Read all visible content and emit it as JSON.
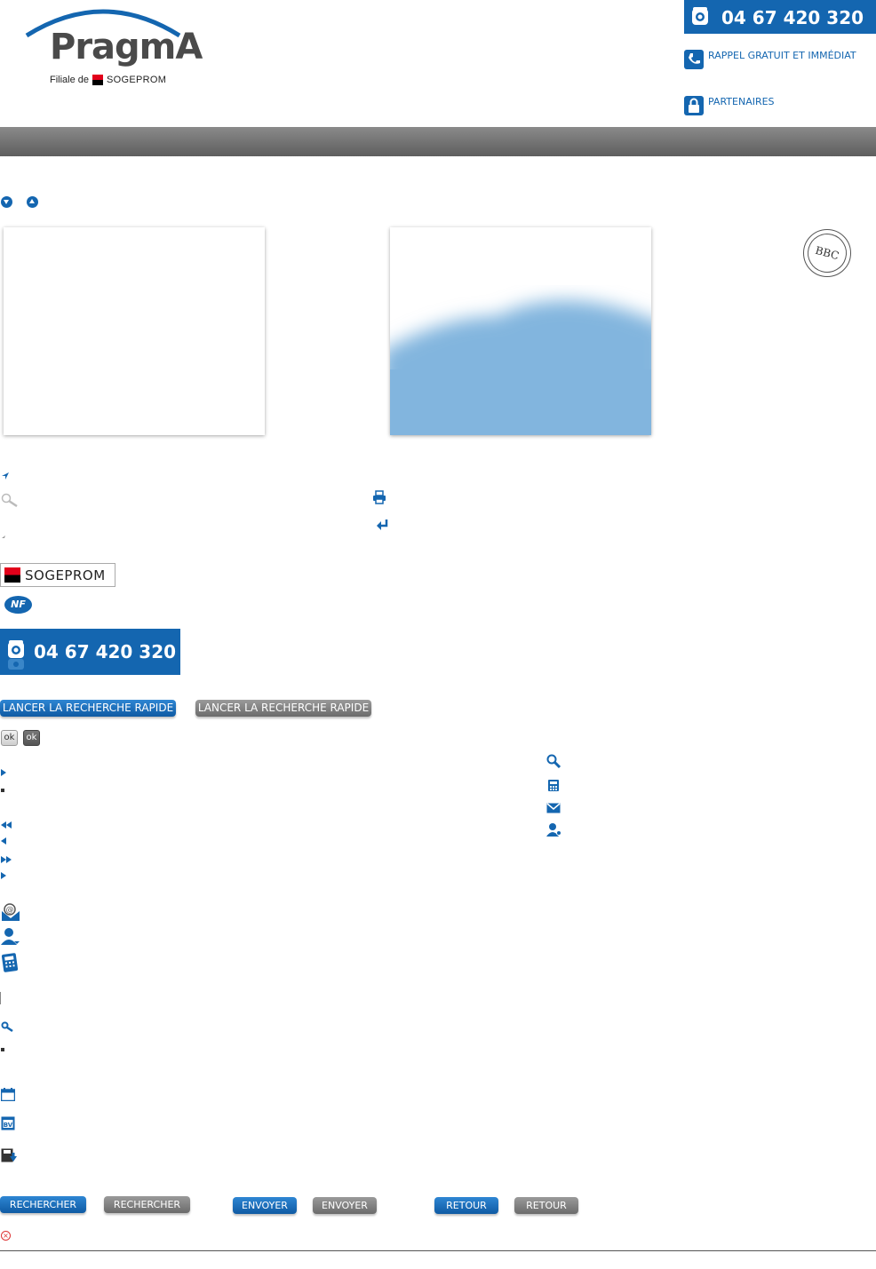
{
  "header": {
    "logo_text": "PragmA",
    "logo_sub_prefix": "Filiale de",
    "logo_sub_brand": "SOGEPROM",
    "phone": "04 67 420 320",
    "callback_label": "RAPPEL GRATUIT ET IMMÉDIAT",
    "partners_label": "PARTENAIRES"
  },
  "badges": {
    "bbc": "BBC",
    "sogeprom": "SOGEPROM",
    "nf": "NF"
  },
  "phone_box": {
    "number": "04 67 420 320"
  },
  "buttons": {
    "quick_search_blue": "LANCER LA RECHERCHE RAPIDE",
    "quick_search_grey": "LANCER LA RECHERCHE RAPIDE",
    "ok_light": "ok",
    "ok_dark": "ok",
    "search_blue": "RECHERCHER",
    "search_grey": "RECHERCHER",
    "send_blue": "ENVOYER",
    "send_grey": "ENVOYER",
    "back_blue": "RETOUR",
    "back_grey": "RETOUR"
  },
  "colors": {
    "brand_blue": "#1466b0",
    "grey_bar": "#6e6e6e",
    "photo_blue": "#82b5de"
  },
  "icons": [
    "arrow-down-circle-icon",
    "arrow-up-circle-icon",
    "location-arrow-icon",
    "magnifier-icon",
    "print-icon",
    "return-icon",
    "phone-icon",
    "lock-icon",
    "search-icon",
    "calculator-icon",
    "mail-icon",
    "user-icon",
    "email-at-icon",
    "calendar-icon",
    "bbc-label-icon",
    "save-icon",
    "error-icon"
  ]
}
